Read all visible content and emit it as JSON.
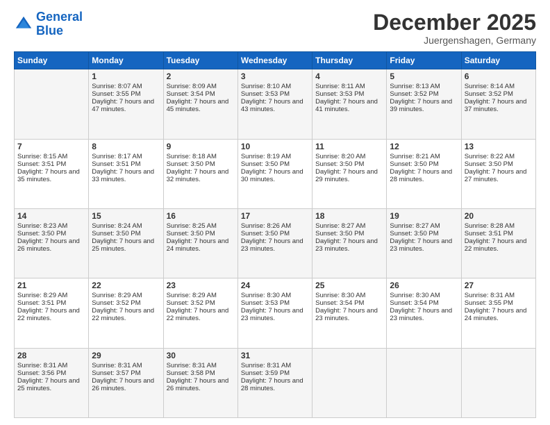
{
  "logo": {
    "line1": "General",
    "line2": "Blue"
  },
  "title": "December 2025",
  "subtitle": "Juergenshagen, Germany",
  "days_header": [
    "Sunday",
    "Monday",
    "Tuesday",
    "Wednesday",
    "Thursday",
    "Friday",
    "Saturday"
  ],
  "weeks": [
    [
      {
        "day": "",
        "sunrise": "",
        "sunset": "",
        "daylight": ""
      },
      {
        "day": "1",
        "sunrise": "Sunrise: 8:07 AM",
        "sunset": "Sunset: 3:55 PM",
        "daylight": "Daylight: 7 hours and 47 minutes."
      },
      {
        "day": "2",
        "sunrise": "Sunrise: 8:09 AM",
        "sunset": "Sunset: 3:54 PM",
        "daylight": "Daylight: 7 hours and 45 minutes."
      },
      {
        "day": "3",
        "sunrise": "Sunrise: 8:10 AM",
        "sunset": "Sunset: 3:53 PM",
        "daylight": "Daylight: 7 hours and 43 minutes."
      },
      {
        "day": "4",
        "sunrise": "Sunrise: 8:11 AM",
        "sunset": "Sunset: 3:53 PM",
        "daylight": "Daylight: 7 hours and 41 minutes."
      },
      {
        "day": "5",
        "sunrise": "Sunrise: 8:13 AM",
        "sunset": "Sunset: 3:52 PM",
        "daylight": "Daylight: 7 hours and 39 minutes."
      },
      {
        "day": "6",
        "sunrise": "Sunrise: 8:14 AM",
        "sunset": "Sunset: 3:52 PM",
        "daylight": "Daylight: 7 hours and 37 minutes."
      }
    ],
    [
      {
        "day": "7",
        "sunrise": "Sunrise: 8:15 AM",
        "sunset": "Sunset: 3:51 PM",
        "daylight": "Daylight: 7 hours and 35 minutes."
      },
      {
        "day": "8",
        "sunrise": "Sunrise: 8:17 AM",
        "sunset": "Sunset: 3:51 PM",
        "daylight": "Daylight: 7 hours and 33 minutes."
      },
      {
        "day": "9",
        "sunrise": "Sunrise: 8:18 AM",
        "sunset": "Sunset: 3:50 PM",
        "daylight": "Daylight: 7 hours and 32 minutes."
      },
      {
        "day": "10",
        "sunrise": "Sunrise: 8:19 AM",
        "sunset": "Sunset: 3:50 PM",
        "daylight": "Daylight: 7 hours and 30 minutes."
      },
      {
        "day": "11",
        "sunrise": "Sunrise: 8:20 AM",
        "sunset": "Sunset: 3:50 PM",
        "daylight": "Daylight: 7 hours and 29 minutes."
      },
      {
        "day": "12",
        "sunrise": "Sunrise: 8:21 AM",
        "sunset": "Sunset: 3:50 PM",
        "daylight": "Daylight: 7 hours and 28 minutes."
      },
      {
        "day": "13",
        "sunrise": "Sunrise: 8:22 AM",
        "sunset": "Sunset: 3:50 PM",
        "daylight": "Daylight: 7 hours and 27 minutes."
      }
    ],
    [
      {
        "day": "14",
        "sunrise": "Sunrise: 8:23 AM",
        "sunset": "Sunset: 3:50 PM",
        "daylight": "Daylight: 7 hours and 26 minutes."
      },
      {
        "day": "15",
        "sunrise": "Sunrise: 8:24 AM",
        "sunset": "Sunset: 3:50 PM",
        "daylight": "Daylight: 7 hours and 25 minutes."
      },
      {
        "day": "16",
        "sunrise": "Sunrise: 8:25 AM",
        "sunset": "Sunset: 3:50 PM",
        "daylight": "Daylight: 7 hours and 24 minutes."
      },
      {
        "day": "17",
        "sunrise": "Sunrise: 8:26 AM",
        "sunset": "Sunset: 3:50 PM",
        "daylight": "Daylight: 7 hours and 23 minutes."
      },
      {
        "day": "18",
        "sunrise": "Sunrise: 8:27 AM",
        "sunset": "Sunset: 3:50 PM",
        "daylight": "Daylight: 7 hours and 23 minutes."
      },
      {
        "day": "19",
        "sunrise": "Sunrise: 8:27 AM",
        "sunset": "Sunset: 3:50 PM",
        "daylight": "Daylight: 7 hours and 23 minutes."
      },
      {
        "day": "20",
        "sunrise": "Sunrise: 8:28 AM",
        "sunset": "Sunset: 3:51 PM",
        "daylight": "Daylight: 7 hours and 22 minutes."
      }
    ],
    [
      {
        "day": "21",
        "sunrise": "Sunrise: 8:29 AM",
        "sunset": "Sunset: 3:51 PM",
        "daylight": "Daylight: 7 hours and 22 minutes."
      },
      {
        "day": "22",
        "sunrise": "Sunrise: 8:29 AM",
        "sunset": "Sunset: 3:52 PM",
        "daylight": "Daylight: 7 hours and 22 minutes."
      },
      {
        "day": "23",
        "sunrise": "Sunrise: 8:29 AM",
        "sunset": "Sunset: 3:52 PM",
        "daylight": "Daylight: 7 hours and 22 minutes."
      },
      {
        "day": "24",
        "sunrise": "Sunrise: 8:30 AM",
        "sunset": "Sunset: 3:53 PM",
        "daylight": "Daylight: 7 hours and 23 minutes."
      },
      {
        "day": "25",
        "sunrise": "Sunrise: 8:30 AM",
        "sunset": "Sunset: 3:54 PM",
        "daylight": "Daylight: 7 hours and 23 minutes."
      },
      {
        "day": "26",
        "sunrise": "Sunrise: 8:30 AM",
        "sunset": "Sunset: 3:54 PM",
        "daylight": "Daylight: 7 hours and 23 minutes."
      },
      {
        "day": "27",
        "sunrise": "Sunrise: 8:31 AM",
        "sunset": "Sunset: 3:55 PM",
        "daylight": "Daylight: 7 hours and 24 minutes."
      }
    ],
    [
      {
        "day": "28",
        "sunrise": "Sunrise: 8:31 AM",
        "sunset": "Sunset: 3:56 PM",
        "daylight": "Daylight: 7 hours and 25 minutes."
      },
      {
        "day": "29",
        "sunrise": "Sunrise: 8:31 AM",
        "sunset": "Sunset: 3:57 PM",
        "daylight": "Daylight: 7 hours and 26 minutes."
      },
      {
        "day": "30",
        "sunrise": "Sunrise: 8:31 AM",
        "sunset": "Sunset: 3:58 PM",
        "daylight": "Daylight: 7 hours and 26 minutes."
      },
      {
        "day": "31",
        "sunrise": "Sunrise: 8:31 AM",
        "sunset": "Sunset: 3:59 PM",
        "daylight": "Daylight: 7 hours and 28 minutes."
      },
      {
        "day": "",
        "sunrise": "",
        "sunset": "",
        "daylight": ""
      },
      {
        "day": "",
        "sunrise": "",
        "sunset": "",
        "daylight": ""
      },
      {
        "day": "",
        "sunrise": "",
        "sunset": "",
        "daylight": ""
      }
    ]
  ]
}
